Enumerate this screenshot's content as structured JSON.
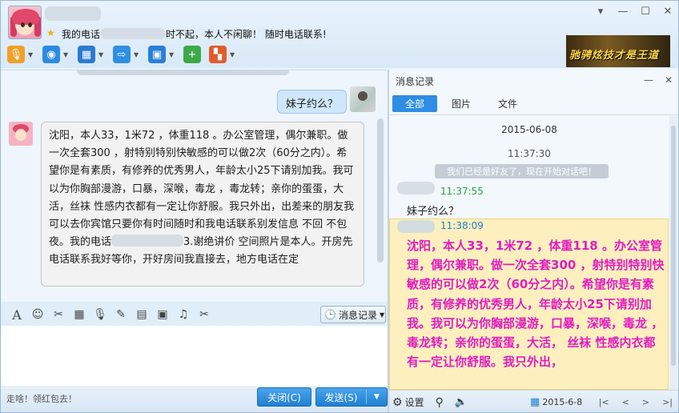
{
  "header": {
    "signature_prefix": "我的电话",
    "signature_suffix": "时不起，本人不闲聊！ 随时电话联系!",
    "banner_text": "驰骋炫技才是王道",
    "window_controls": [
      "▾",
      "—",
      "☐",
      "✕"
    ]
  },
  "toolbar": {
    "tools": [
      {
        "icon": "microphone-icon",
        "glyph": "🎙",
        "color": "#f0a02a"
      },
      {
        "icon": "camera-icon",
        "glyph": "◉",
        "color": "#2d8be0"
      },
      {
        "icon": "screen-share-icon",
        "glyph": "▦",
        "color": "#2b7ad0"
      },
      {
        "icon": "folder-transfer-icon",
        "glyph": "⇨",
        "color": "#2f8fe3"
      },
      {
        "icon": "remote-desktop-icon",
        "glyph": "▣",
        "color": "#2a7fd6"
      },
      {
        "icon": "add-chat-icon",
        "glyph": "+",
        "color": "#3caa4a"
      },
      {
        "icon": "apps-icon",
        "glyph": "▚",
        "color": "#e35b2c"
      }
    ]
  },
  "chat": {
    "outgoing_message": "妹子约么？",
    "incoming_message_part1": "沈阳，本人33，1米72 ，体重118 。办公室管理，偶尔兼职。做一次全套300 ，射特别特别快敏感的可以做2次（60分之内）。希望你是有素质，有修养的优秀男人，年龄太小25下请别加我。我可以为你胸部漫游，口暴，深喉，毒龙 ，毒龙转；亲你的蛋蛋，大活，丝袜 性感内衣都有一定让你舒服。我只外出，出差来的朋友我可以去你宾馆只要你有时间随时和我电话联系别发信息 不回 不包夜。我的电话",
    "incoming_message_part2": "3.谢绝讲价  空间照片是本人。开房先电话联系我好等你，开好房间我直接去，地方电话在定"
  },
  "compose": {
    "tools": [
      "A",
      "☺",
      "✂",
      "▦",
      "🎙",
      "✎",
      "▤",
      "▣",
      "♫",
      "✂"
    ],
    "tool_names": [
      "font-icon",
      "emoji-icon",
      "magic-icon",
      "gallery-icon",
      "voice-icon",
      "edit-icon",
      "image-icon",
      "screenshot-icon",
      "music-icon",
      "scissors-icon"
    ],
    "history_button": "消息记录",
    "status": "走啥！领红包去！",
    "close_button": "关闭(C)",
    "send_button": "发送(S)"
  },
  "history": {
    "title": "消息记录",
    "tabs": [
      "全部",
      "图片",
      "文件"
    ],
    "date": "2015-06-08",
    "time_system": "11:37:30",
    "system_message": "我们已经是好友了，现在开始对话吧！",
    "time_msg1": "11:37:55",
    "msg1": "妹子约么？",
    "time_msg2": "11:38:09",
    "msg2": "沈阳，本人33，1米72 ，体重118 。办公室管理，偶尔兼职。做一次全套300 ，射特别特别快敏感的可以做2次（60分之内）。希望你是有素质，有修养的优秀男人，年龄太小25下请别加我。我可以为你胸部漫游，口暴，深喉，毒龙 ，毒龙转；亲你的蛋蛋，大活， 丝袜 性感内衣都有一定让你舒服。我只外出，",
    "settings_label": "设置",
    "footer_date": "2015-6-8"
  }
}
